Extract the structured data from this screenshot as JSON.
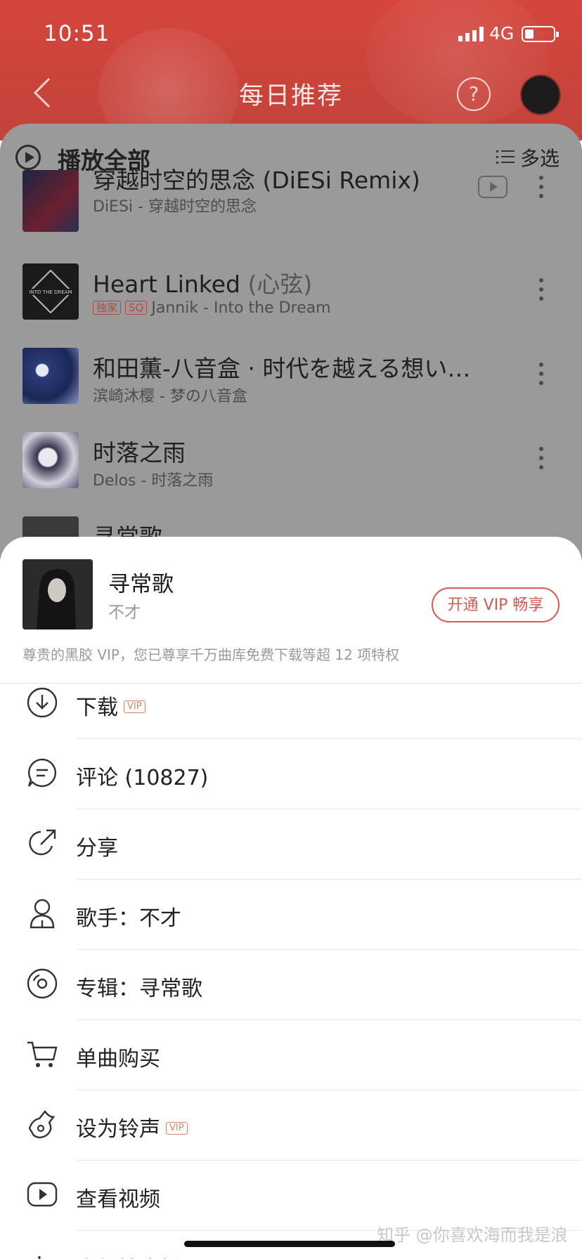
{
  "status_bar": {
    "time": "10:51",
    "network": "4G"
  },
  "header": {
    "title": "每日推荐",
    "help_label": "?"
  },
  "list_header": {
    "play_all": "播放全部",
    "multi_select": "多选"
  },
  "songs": [
    {
      "title": "穿越时空的思念 (DiESi Remix)",
      "subtitle": "",
      "meta": "DiESi - 穿越时空的思念",
      "tags": []
    },
    {
      "title": "Heart Linked ",
      "subtitle": "(心弦)",
      "meta": "Jannik - Into the Dream",
      "tags": [
        "独家",
        "SQ"
      ]
    },
    {
      "title": "和田薫-八音盒 · 时代を越える想い…",
      "subtitle": "",
      "meta": "滨崎沐樱 - 梦の八音盒",
      "tags": []
    },
    {
      "title": "时落之雨",
      "subtitle": "",
      "meta": "Delos - 时落之雨",
      "tags": []
    },
    {
      "title": "寻常歌",
      "subtitle": "",
      "meta": "",
      "tags": []
    }
  ],
  "sheet": {
    "song_title": "寻常歌",
    "artist": "不才",
    "vip_button": "开通 VIP 畅享",
    "vip_note": "尊贵的黑胶 VIP，您已尊享千万曲库免费下载等超 12 项特权",
    "menu": [
      {
        "label": "下载",
        "icon": "download-icon",
        "vip": "VIP"
      },
      {
        "label": "评论 (10827)",
        "icon": "comment-icon",
        "vip": ""
      },
      {
        "label": "分享",
        "icon": "share-icon",
        "vip": ""
      },
      {
        "label": "歌手：不才",
        "icon": "singer-icon",
        "vip": ""
      },
      {
        "label": "专辑：寻常歌",
        "icon": "album-icon",
        "vip": ""
      },
      {
        "label": "单曲购买",
        "icon": "cart-icon",
        "vip": ""
      },
      {
        "label": "设为铃声",
        "icon": "ringtone-icon",
        "vip": "VIP"
      },
      {
        "label": "查看视频",
        "icon": "video-icon",
        "vip": ""
      },
      {
        "label": "人气榜应援",
        "icon": "chart-icon",
        "vip": ""
      }
    ]
  },
  "watermark": "知乎 @你喜欢海而我是浪",
  "colors": {
    "header_red": "#c9443b",
    "vip_red": "#d55a4f"
  }
}
